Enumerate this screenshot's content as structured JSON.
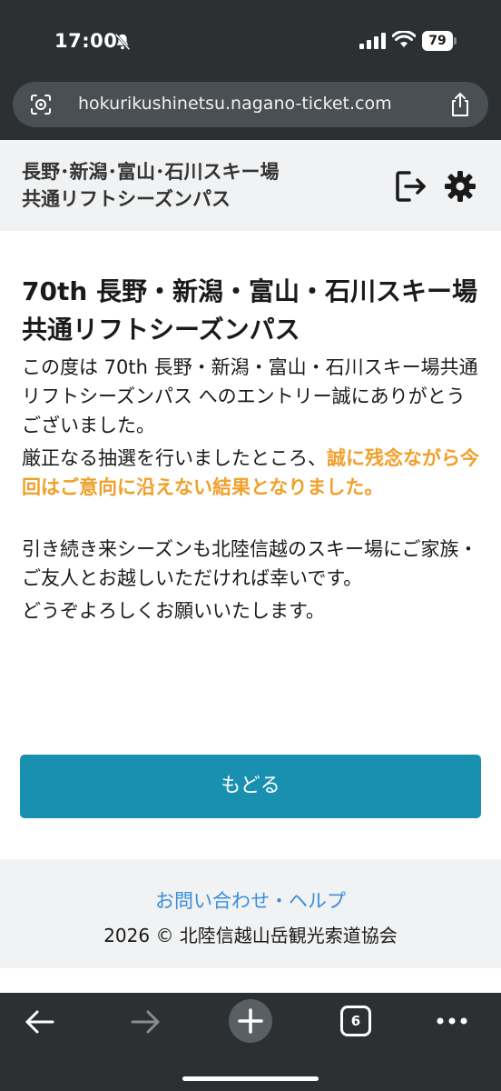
{
  "status_bar": {
    "time": "17:00",
    "battery": "79"
  },
  "browser": {
    "url": "hokurikushinetsu.nagano-ticket.com",
    "tab_count": "6"
  },
  "header": {
    "title_line1": "長野･新潟･富山･石川スキー場",
    "title_line2": "共通リフトシーズンパス"
  },
  "main": {
    "title": "70th 長野・新潟・富山・石川スキー場共通リフトシーズンパス",
    "para1": "この度は 70th 長野・新潟・富山・石川スキー場共通リフトシーズンパス へのエントリー誠にありがとうございました。",
    "para2_plain": "厳正なる抽選を行いましたところ、",
    "para2_highlight": "誠に残念ながら今回はご意向に沿えない結果となりました。",
    "para3": "引き続き来シーズンも北陸信越のスキー場にご家族・ご友人とお越しいただければ幸いです。",
    "para4": "どうぞよろしくお願いいたします。",
    "back_button_label": "もどる"
  },
  "footer": {
    "help_link": "お問い合わせ・ヘルプ",
    "copyright": "2026 © 北陸信越山岳観光索道協会"
  },
  "colors": {
    "accent": "#1a90b0",
    "highlight": "#f0a02a",
    "link": "#3b8ed8",
    "chrome": "#2c3033"
  }
}
